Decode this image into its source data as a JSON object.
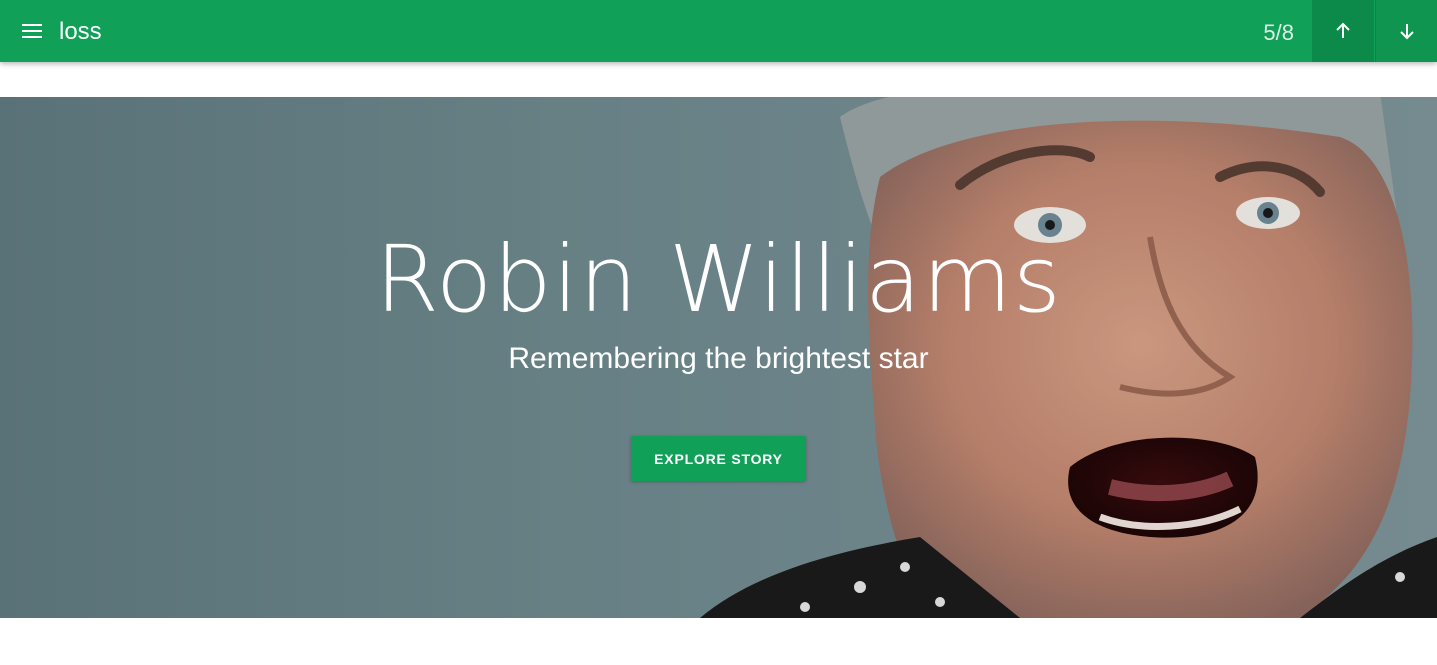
{
  "appbar": {
    "title": "loss",
    "counter": "5/8",
    "menu_icon": "hamburger-menu-icon",
    "up_icon": "arrow-up-icon",
    "down_icon": "arrow-down-icon",
    "color": "#11a058"
  },
  "hero": {
    "title": "Robin Williams",
    "subtitle": "Remembering the brightest star",
    "button_label": "EXPLORE STORY",
    "accent": "#11a058",
    "background_tone": "#6f878c"
  }
}
